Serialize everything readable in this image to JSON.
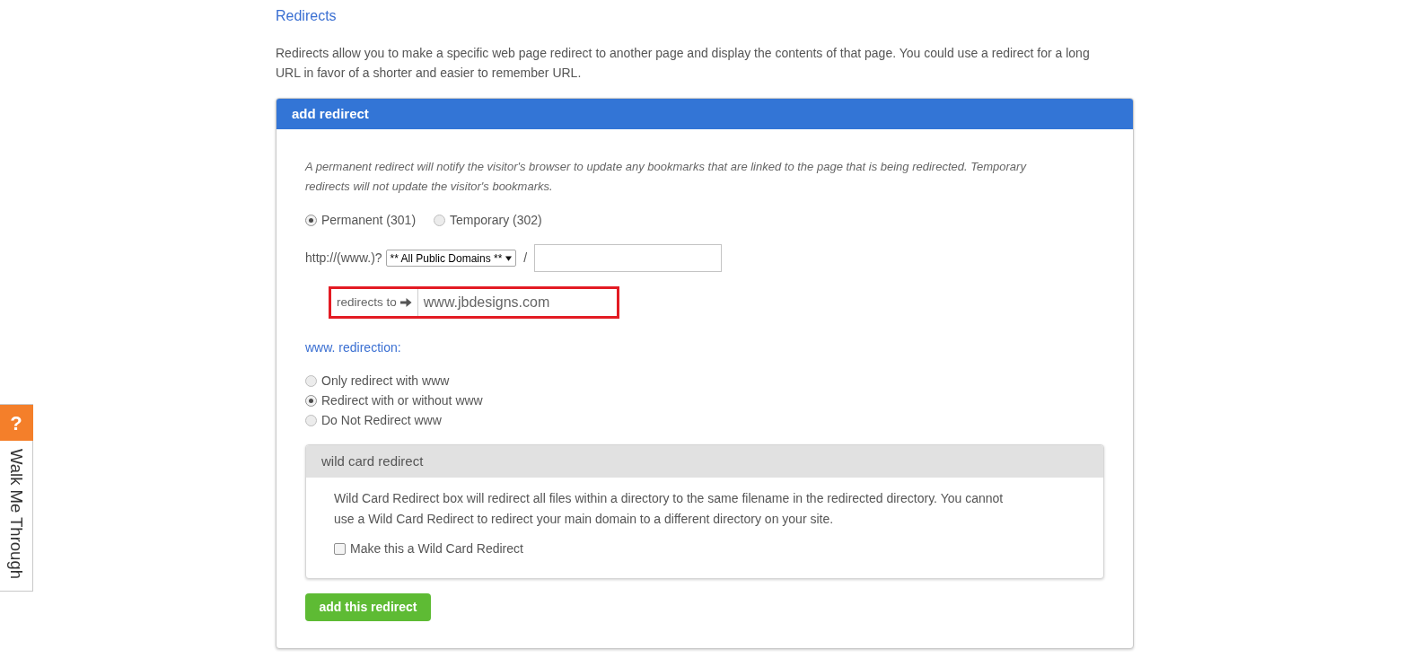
{
  "page": {
    "title": "Redirects",
    "intro": "Redirects allow you to make a specific web page redirect to another page and display the contents of that page. You could use a redirect for a long URL in favor of a shorter and easier to remember URL."
  },
  "card": {
    "title": "add redirect",
    "note": "A permanent redirect will notify the visitor's browser to update any bookmarks that are linked to the page that is being redirected. Temporary redirects will not update the visitor's bookmarks.",
    "redirect_types": [
      {
        "label": "Permanent (301)",
        "selected": true
      },
      {
        "label": "Temporary (302)",
        "selected": false
      }
    ],
    "source": {
      "prefix": "http://(www.)?",
      "domain_select": "** All Public Domains **",
      "separator": "/"
    },
    "target": {
      "label": "redirects to",
      "value": "www.jbdesigns.com",
      "highlighted": true
    },
    "www_redirection": {
      "title": "www. redirection:",
      "options": [
        {
          "label": "Only redirect with www",
          "selected": false
        },
        {
          "label": "Redirect with or without www",
          "selected": true
        },
        {
          "label": "Do Not Redirect www",
          "selected": false
        }
      ]
    },
    "wild_card": {
      "title": "wild card redirect",
      "description": "Wild Card Redirect box will redirect all files within a directory to the same filename in the redirected directory. You cannot use a Wild Card Redirect to redirect your main domain to a different directory on your site.",
      "checkbox": {
        "label": "Make this a Wild Card Redirect",
        "checked": false
      }
    },
    "submit_button": "add this redirect"
  },
  "help_tab": {
    "icon": "?",
    "label": "Walk Me Through"
  }
}
